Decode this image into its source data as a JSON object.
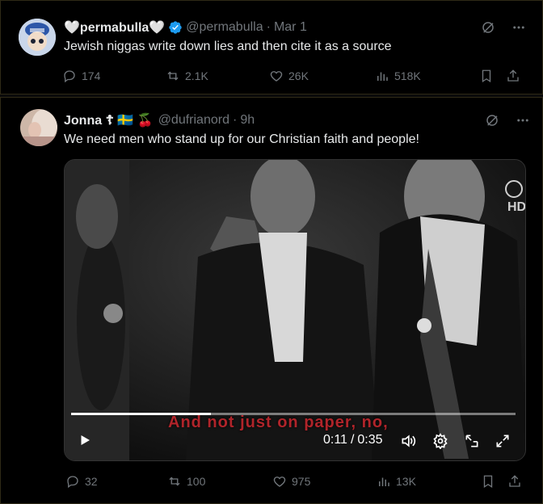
{
  "tweet1": {
    "display_name": "🤍permabulla🤍",
    "handle": "@permabulla",
    "sep": "·",
    "date": "Mar 1",
    "text": "Jewish niggas write down lies and then cite it as a source",
    "replies": "174",
    "retweets": "2.1K",
    "likes": "26K",
    "views": "518K"
  },
  "tweet2": {
    "display_name": "Jonna ☦ 🇸🇪 🍒",
    "handle": "@dufrianord",
    "sep": "·",
    "date": "9h",
    "text": "We need men who stand up for our Christian faith and people!",
    "replies": "32",
    "retweets": "100",
    "likes": "975",
    "views": "13K"
  },
  "video": {
    "subtitle": "And not just on paper, no,",
    "current_time": "0:11",
    "time_sep": "/",
    "duration": "0:35",
    "progress": 0.314,
    "watermark": "HD"
  },
  "colors": {
    "verified": "#1d9bf0",
    "muted": "#71767b",
    "text": "#e7e9ea",
    "subtitle": "#b0242a"
  }
}
